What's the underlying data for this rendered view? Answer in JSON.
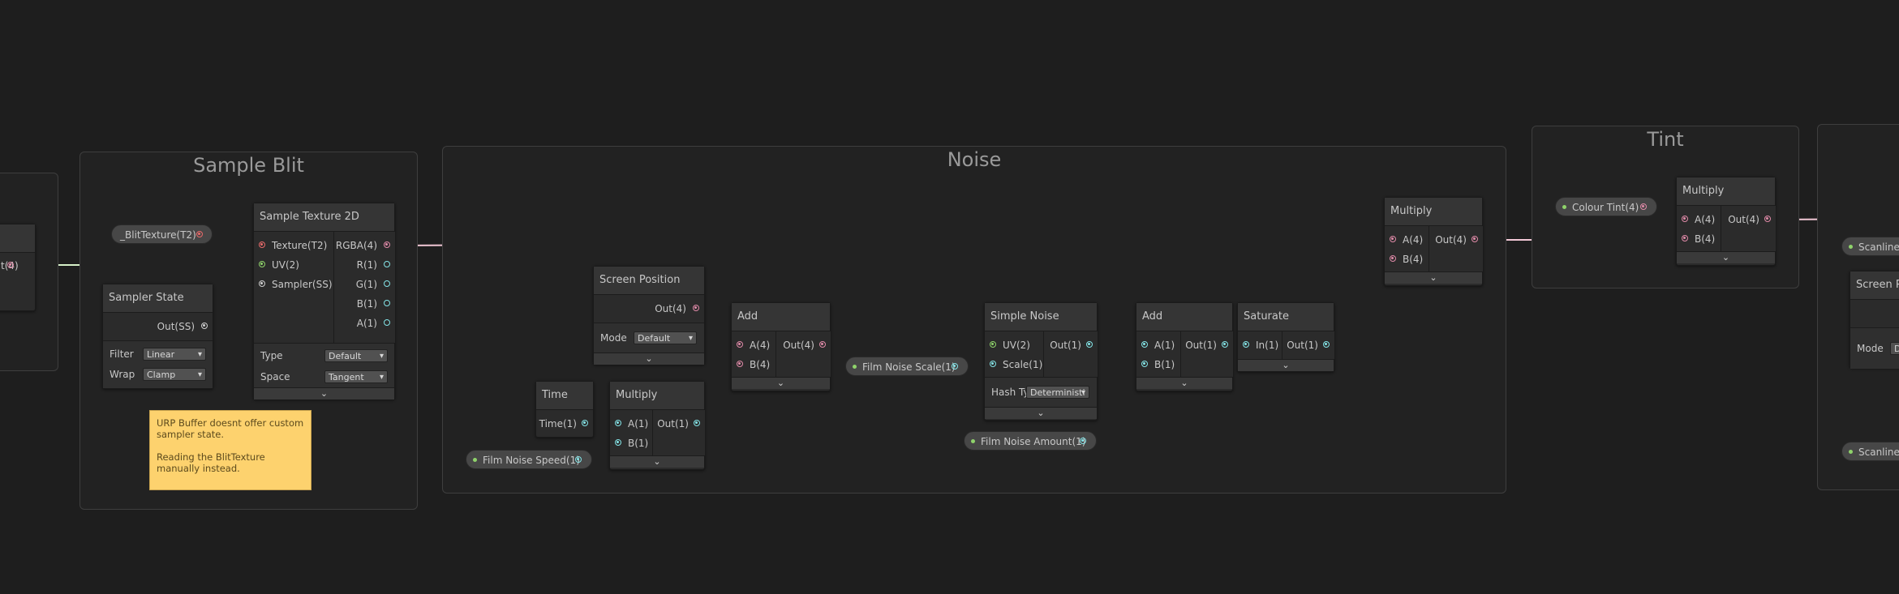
{
  "groups": {
    "sample_blit": "Sample Blit",
    "noise": "Noise",
    "tint": "Tint"
  },
  "left_node": {
    "out_label": "t(4)"
  },
  "blit_texture_property": "_BlitTexture(T2)",
  "sample_texture": {
    "title": "Sample Texture 2D",
    "inputs": [
      "Texture(T2)",
      "UV(2)",
      "Sampler(SS)"
    ],
    "outputs": [
      "RGBA(4)",
      "R(1)",
      "G(1)",
      "B(1)",
      "A(1)"
    ],
    "type_label": "Type",
    "type_value": "Default",
    "space_label": "Space",
    "space_value": "Tangent",
    "collapse_icon": "chevron-down-icon"
  },
  "sampler_state": {
    "title": "Sampler State",
    "output": "Out(SS)",
    "filter_label": "Filter",
    "filter_value": "Linear",
    "wrap_label": "Wrap",
    "wrap_value": "Clamp"
  },
  "sticky_note": {
    "line1": "URP Buffer doesnt offer custom sampler state.",
    "line2": "Reading the BlitTexture manually instead."
  },
  "screen_position": {
    "title": "Screen Position",
    "output": "Out(4)",
    "mode_label": "Mode",
    "mode_value": "Default"
  },
  "time_node": {
    "title": "Time",
    "output": "Time(1)"
  },
  "multiply_speed": {
    "title": "Multiply",
    "inputs": [
      "A(1)",
      "B(1)"
    ],
    "output": "Out(1)"
  },
  "film_noise_speed": "Film Noise Speed(1)",
  "add_uv": {
    "title": "Add",
    "inputs": [
      "A(4)",
      "B(4)"
    ],
    "output": "Out(4)"
  },
  "film_noise_scale": "Film Noise Scale(1)",
  "simple_noise": {
    "title": "Simple Noise",
    "inputs": [
      "UV(2)",
      "Scale(1)"
    ],
    "output": "Out(1)",
    "hash_label": "Hash Ty",
    "hash_value": "Deterministi"
  },
  "film_noise_amount": "Film Noise Amount(1)",
  "add_noise": {
    "title": "Add",
    "inputs": [
      "A(1)",
      "B(1)"
    ],
    "output": "Out(1)"
  },
  "saturate": {
    "title": "Saturate",
    "input": "In(1)",
    "output": "Out(1)"
  },
  "multiply_noise": {
    "title": "Multiply",
    "inputs": [
      "A(4)",
      "B(4)"
    ],
    "output": "Out(4)"
  },
  "colour_tint": "Colour Tint(4)",
  "multiply_tint": {
    "title": "Multiply",
    "inputs": [
      "A(4)",
      "B(4)"
    ],
    "output": "Out(4)"
  },
  "right_edge": {
    "scanline_a": "Scanline A",
    "screen_pos_title": "Screen Po",
    "mode_label": "Mode",
    "mode_value": "D",
    "scanline_s": "Scanline S"
  },
  "colors": {
    "background": "#1e1e1e",
    "vector4_port": "#e08aa8",
    "vector2_port": "#8fd36b",
    "vector1_port": "#84e4e7",
    "texture_port": "#e96a6a",
    "sticky_note": "#fdd26e"
  }
}
